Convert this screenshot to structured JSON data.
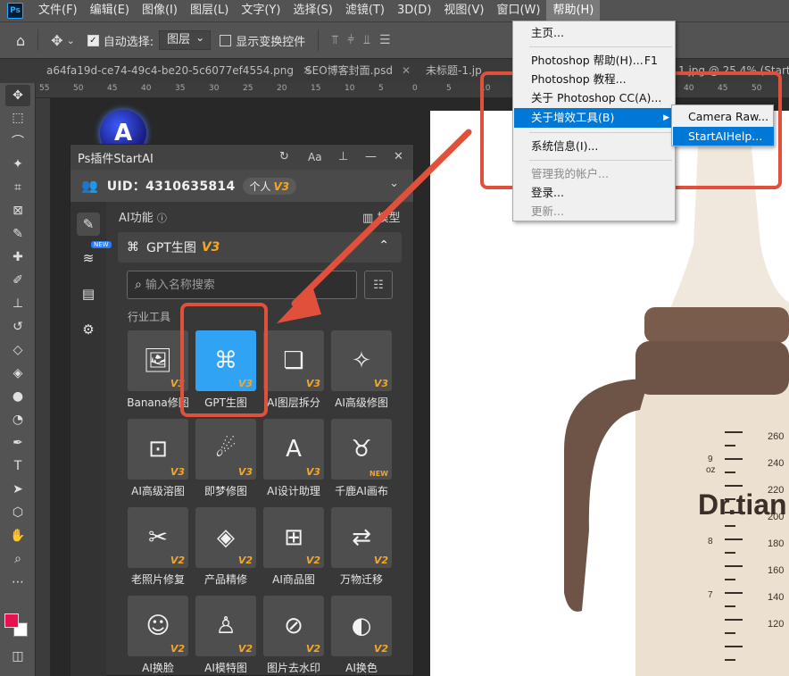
{
  "app": {
    "logo": "Ps"
  },
  "menubar": {
    "items": [
      "文件(F)",
      "编辑(E)",
      "图像(I)",
      "图层(L)",
      "文字(Y)",
      "选择(S)",
      "滤镜(T)",
      "3D(D)",
      "视图(V)",
      "窗口(W)",
      "帮助(H)"
    ],
    "active_index": 10
  },
  "options": {
    "auto_select_label": "自动选择:",
    "auto_select_value": "图层",
    "show_transform_label": "显示变换控件"
  },
  "tabs": [
    {
      "label": "a64fa19d-ce74-49c4-be20-5c6077ef4554.png"
    },
    {
      "label": "SEO博客封面.psd"
    },
    {
      "label": "未标题-1.jp"
    }
  ],
  "tab_partial_right": "1.jpg @ 25.4% (StartAl",
  "ruler_numbers": [
    "55",
    "50",
    "45",
    "40",
    "35",
    "30",
    "25",
    "20",
    "15",
    "10",
    "5",
    "0",
    "5",
    "10",
    "15",
    "20",
    "25",
    "30",
    "35",
    "40",
    "45",
    "50"
  ],
  "panel": {
    "title": "Ps插件StartAI",
    "font_label": "Aa",
    "uid_label": "UID：4310635814",
    "plan_label": "个人",
    "plan_version": "V3",
    "new_tag": "NEW",
    "ai_section_label": "AI功能",
    "ai_section_right": "模型",
    "subsection_label": "GPT生图",
    "subsection_version": "V3",
    "search_placeholder": "输入名称搜索",
    "category_label": "行业工具",
    "tools": [
      {
        "name": "Banana修图",
        "version": "V3",
        "icon": "image-edit-icon"
      },
      {
        "name": "GPT生图",
        "version": "V3",
        "icon": "gpt-logo-icon"
      },
      {
        "name": "AI图层拆分",
        "version": "V3",
        "icon": "layer-split-icon"
      },
      {
        "name": "AI高级修图",
        "version": "V3",
        "icon": "magic-wand-icon"
      },
      {
        "name": "AI高级溶图",
        "version": "V3",
        "icon": "blend-image-icon"
      },
      {
        "name": "即梦修图",
        "version": "V3",
        "icon": "dream-icon"
      },
      {
        "name": "AI设计助理",
        "version": "V3",
        "icon": "design-assistant-icon"
      },
      {
        "name": "千鹿AI画布",
        "version": "NEW",
        "icon": "deer-icon"
      },
      {
        "name": "老照片修复",
        "version": "V2",
        "icon": "photo-restore-icon"
      },
      {
        "name": "产品精修",
        "version": "V2",
        "icon": "diamond-icon"
      },
      {
        "name": "AI商品图",
        "version": "V2",
        "icon": "product-bag-icon"
      },
      {
        "name": "万物迁移",
        "version": "V2",
        "icon": "transfer-icon"
      },
      {
        "name": "AI换脸",
        "version": "V2",
        "icon": "face-swap-icon"
      },
      {
        "name": "AI模特图",
        "version": "V2",
        "icon": "model-icon"
      },
      {
        "name": "图片去水印",
        "version": "V2",
        "icon": "watermark-remove-icon"
      },
      {
        "name": "AI换色",
        "version": "V2",
        "icon": "recolor-icon"
      }
    ]
  },
  "help_menu": {
    "items": [
      {
        "label": "主页..."
      },
      {
        "label": "Photoshop 帮助(H)...",
        "shortcut": "F1"
      },
      {
        "label": "Photoshop 教程..."
      },
      {
        "label": "关于 Photoshop CC(A)..."
      },
      {
        "label": "关于增效工具(B)"
      },
      {
        "label": "系统信息(I)..."
      },
      {
        "label": "管理我的帐户..."
      },
      {
        "label": "登录..."
      },
      {
        "label": "更新..."
      }
    ],
    "submenu": [
      "Camera Raw...",
      "StartAIHelp..."
    ]
  },
  "artboard": {
    "brand_text": "Dr.tian",
    "scale_numbers": [
      "260",
      "240",
      "220",
      "200",
      "180",
      "160",
      "140",
      "120"
    ],
    "oz_marks": [
      "9",
      "oz",
      "8",
      "7"
    ]
  },
  "colors": {
    "accent": "#31a3f5",
    "annotation": "#e0503a",
    "fg_swatch": "#e8114f",
    "bottle_brown": "#6e5446"
  }
}
